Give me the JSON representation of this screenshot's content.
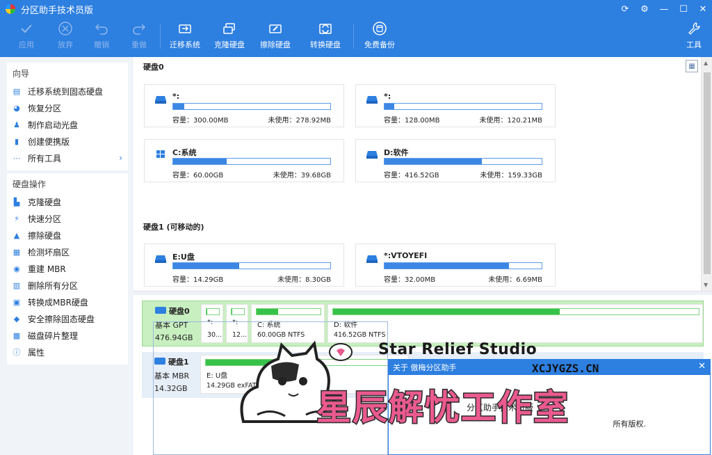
{
  "window": {
    "title": "分区助手技术员版"
  },
  "toolbar": {
    "apply": "应用",
    "discard": "放弃",
    "undo": "撤销",
    "redo": "重做",
    "migrate": "迁移系统",
    "clone": "克隆硬盘",
    "wipe": "擦除硬盘",
    "convert": "转换硬盘",
    "backup": "免费备份",
    "tools": "工具"
  },
  "sidebar": {
    "wizard_title": "向导",
    "wizard_items": [
      "迁移系统到固态硬盘",
      "恢复分区",
      "制作启动光盘",
      "创建便携版",
      "所有工具"
    ],
    "disk_ops_title": "硬盘操作",
    "disk_items": [
      "克隆硬盘",
      "快速分区",
      "擦除硬盘",
      "检测坏扇区",
      "重建 MBR",
      "删除所有分区",
      "转换成MBR硬盘",
      "安全擦除固态硬盘",
      "磁盘碎片整理",
      "属性"
    ]
  },
  "disks": {
    "disk0_title": "硬盘0",
    "disk1_title": "硬盘1 (可移动的)",
    "partitions": [
      {
        "name": "*:",
        "capacity": "容量：300.00MB",
        "free": "未使用：278.92MB",
        "used_fraction": 0.07
      },
      {
        "name": "*:",
        "capacity": "容量：128.00MB",
        "free": "未使用：120.21MB",
        "used_fraction": 0.06
      },
      {
        "name": "C:系统",
        "capacity": "容量：60.00GB",
        "free": "未使用：39.68GB",
        "used_fraction": 0.34
      },
      {
        "name": "D:软件",
        "capacity": "容量：416.52GB",
        "free": "未使用：159.33GB",
        "used_fraction": 0.62
      },
      {
        "name": "E:U盘",
        "capacity": "容量：14.29GB",
        "free": "未使用：8.30GB",
        "used_fraction": 0.42
      },
      {
        "name": "*:VTOYEFI",
        "capacity": "容量：32.00MB",
        "free": "未使用：6.69MB",
        "used_fraction": 0.79
      }
    ]
  },
  "diskmap": {
    "disk0": {
      "label": "硬盘0",
      "type": "基本 GPT",
      "size": "476.94GB"
    },
    "disk1": {
      "label": "硬盘1",
      "type": "基本 MBR",
      "size": "14.32GB"
    },
    "disk0_parts": [
      {
        "name": "*:",
        "detail": "30...",
        "fill": 0.07
      },
      {
        "name": "*:",
        "detail": "12...",
        "fill": 0.06
      },
      {
        "name": "C: 系统",
        "detail": "60.00GB NTFS",
        "fill": 0.34
      },
      {
        "name": "D: 软件",
        "detail": "416.52GB NTFS",
        "fill": 0.62
      }
    ],
    "disk1_parts": [
      {
        "name": "E: U盘",
        "detail": "14.29GB exFAT",
        "fill": 0.42
      }
    ]
  },
  "about": {
    "title": "关于 傲梅分区助手",
    "product": "分区助手技术员版 ",
    "rights": "所有版权."
  },
  "watermark": {
    "studio": "Star Relief Studio",
    "url": "XCJYGZS.CN",
    "cn": "星辰解忧工作室"
  },
  "colors": {
    "accent": "#2d7fe0",
    "used_bar": "#3c87e4",
    "map_bar": "#37c34a",
    "watermark_pink": "#ea5a8e"
  }
}
